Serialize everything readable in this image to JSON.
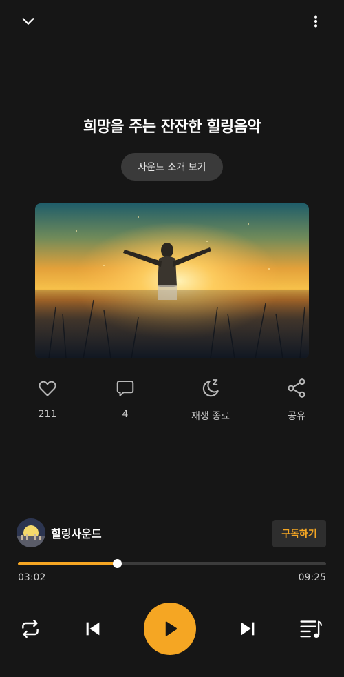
{
  "header": {
    "collapse_icon": "chevron-down-icon",
    "more_icon": "more-vertical-icon"
  },
  "track": {
    "title": "희망을 주는 잔잔한 힐링음악",
    "intro_button_label": "사운드 소개 보기"
  },
  "actions": [
    {
      "icon": "heart-icon",
      "label": "211"
    },
    {
      "icon": "comment-icon",
      "label": "4"
    },
    {
      "icon": "sleep-timer-icon",
      "label": "재생 종료"
    },
    {
      "icon": "share-icon",
      "label": "공유"
    }
  ],
  "channel": {
    "name": "힐링사운드",
    "subscribe_label": "구독하기"
  },
  "player": {
    "current_time": "03:02",
    "total_time": "09:25",
    "progress": 0.3221,
    "accent_color": "#f5a623"
  },
  "controls": {
    "repeat_icon": "repeat-icon",
    "previous_icon": "skip-previous-icon",
    "play_icon": "play-icon",
    "next_icon": "skip-next-icon",
    "playlist_icon": "playlist-icon"
  }
}
